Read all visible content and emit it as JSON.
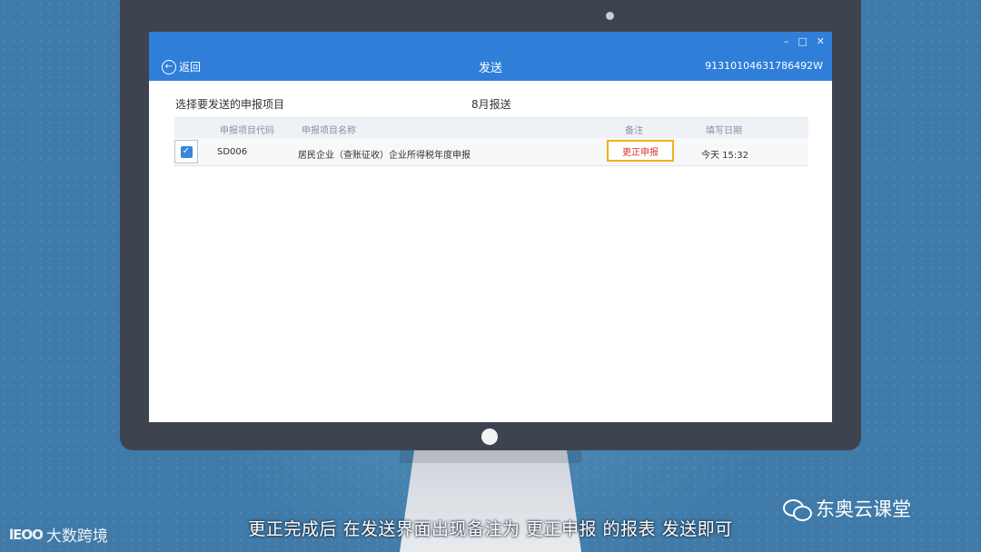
{
  "window": {
    "title": "发送",
    "back_label": "返回",
    "tax_id": "91310104631786492W",
    "controls": [
      "–",
      "□",
      "✕"
    ]
  },
  "content": {
    "section_label": "选择要发送的申报项目",
    "period": "8月报送",
    "table": {
      "headers": {
        "code": "申报项目代码",
        "name": "申报项目名称",
        "remark": "备注",
        "date": "填写日期"
      },
      "rows": [
        {
          "checked": true,
          "code": "SD006",
          "name": "居民企业（查账征收）企业所得税年度申报",
          "remark": "更正申报",
          "date": "今天 15:32"
        }
      ]
    }
  },
  "overlay": {
    "subtitle": "更正完成后 在发送界面出现备注为 更正申报 的报表 发送即可",
    "brand_right": "东奥云课堂",
    "brand_left_logo": "lEOO",
    "brand_left_text": "大数跨境"
  },
  "colors": {
    "titlebar": "#2f7fd9",
    "highlight_border": "#f2b21b",
    "remark_text": "#e0342a",
    "background": "#3f7aa8"
  },
  "icons": {
    "back": "back-arrow-circle-icon",
    "checkbox": "checkmark-icon",
    "wechat": "wechat-icon"
  }
}
